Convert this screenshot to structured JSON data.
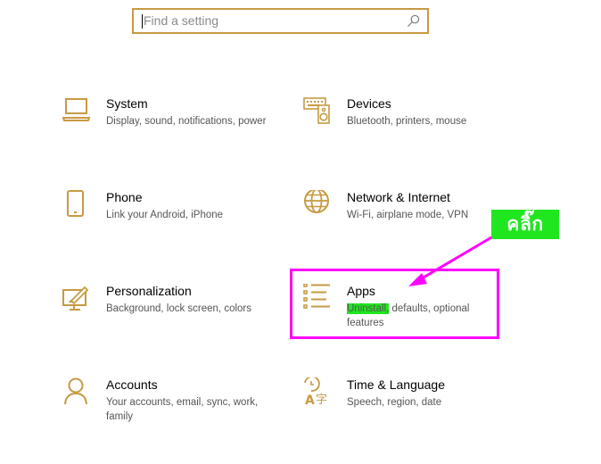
{
  "search": {
    "placeholder": "Find a setting"
  },
  "categories": [
    {
      "title": "System",
      "desc": "Display, sound, notifications, power",
      "icon": "laptop-icon"
    },
    {
      "title": "Devices",
      "desc": "Bluetooth, printers, mouse",
      "icon": "keyboard-speaker-icon"
    },
    {
      "title": "Phone",
      "desc": "Link your Android, iPhone",
      "icon": "phone-icon"
    },
    {
      "title": "Network & Internet",
      "desc": "Wi-Fi, airplane mode, VPN",
      "icon": "globe-icon"
    },
    {
      "title": "Personalization",
      "desc": "Background, lock screen, colors",
      "icon": "paint-screen-icon"
    },
    {
      "title": "Apps",
      "desc_highlight": "Uninstall,",
      "desc_rest": " defaults, optional features",
      "icon": "apps-list-icon"
    },
    {
      "title": "Accounts",
      "desc": "Your accounts, email, sync, work, family",
      "icon": "person-icon"
    },
    {
      "title": "Time & Language",
      "desc": "Speech, region, date",
      "icon": "time-language-icon"
    }
  ],
  "annotation": {
    "label": "คลิ๊ก"
  },
  "colors": {
    "accent": "#c79a43",
    "highlight": "#1fe61f",
    "callout": "#ff00ff"
  }
}
